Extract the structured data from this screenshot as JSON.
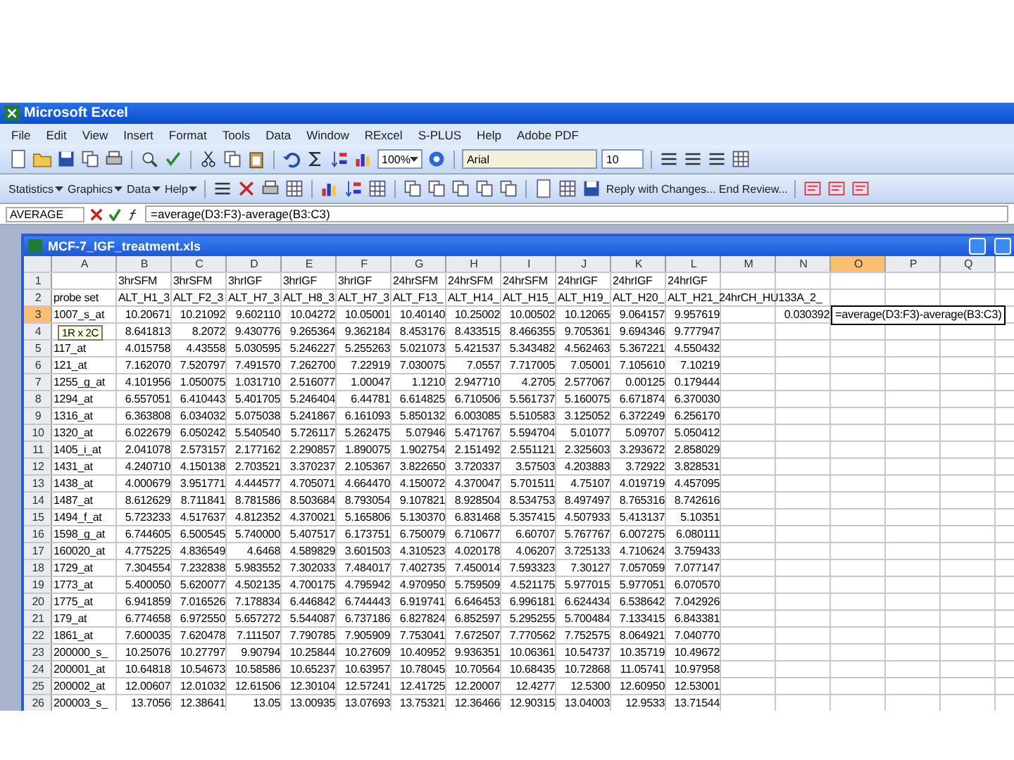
{
  "window": {
    "title": "Microsoft Excel"
  },
  "menu": [
    "File",
    "Edit",
    "View",
    "Insert",
    "Format",
    "Tools",
    "Data",
    "Window",
    "RExcel",
    "S-PLUS",
    "Help",
    "Adobe PDF"
  ],
  "toolbar": {
    "zoom": "100%",
    "font": "Arial",
    "font_size": "10"
  },
  "toolbar2": {
    "menus": [
      "Statistics",
      "Graphics",
      "Data",
      "Help"
    ],
    "review": "Reply with Changes... End Review..."
  },
  "formula_bar": {
    "name_box": "AVERAGE",
    "formula": "=average(D3:F3)-average(B3:C3)"
  },
  "workbook": {
    "title": "MCF-7_IGF_treatment.xls",
    "columns": [
      {
        "label": "A",
        "selected": false
      },
      {
        "label": "B",
        "selected": false
      },
      {
        "label": "C",
        "selected": false
      },
      {
        "label": "D",
        "selected": false
      },
      {
        "label": "E",
        "selected": false
      },
      {
        "label": "F",
        "selected": false
      },
      {
        "label": "G",
        "selected": false
      },
      {
        "label": "H",
        "selected": false
      },
      {
        "label": "I",
        "selected": false
      },
      {
        "label": "J",
        "selected": false
      },
      {
        "label": "K",
        "selected": false
      },
      {
        "label": "L",
        "selected": false
      },
      {
        "label": "M",
        "selected": false
      },
      {
        "label": "N",
        "selected": false
      },
      {
        "label": "O",
        "selected": true
      },
      {
        "label": "P",
        "selected": false
      },
      {
        "label": "Q",
        "selected": false
      }
    ],
    "tooltip": "1R x 2C",
    "rows": [
      {
        "number": "1",
        "selected": false,
        "cells": [
          null,
          "3hrSFM",
          "3hrSFM",
          "3hrIGF",
          "3hrIGF",
          "3hrIGF",
          "24hrSFM",
          "24hrSFM",
          "24hrSFM",
          "24hrIGF",
          "24hrIGF",
          "24hrIGF"
        ]
      },
      {
        "number": "2",
        "selected": false,
        "cells": [
          "probe set",
          "ALT_H1_3",
          "ALT_F2_3",
          "ALT_H7_3",
          "ALT_H8_3",
          "ALT_H7_3",
          "ALT_F13_",
          "ALT_H14_",
          "ALT_H15_",
          "ALT_H19_",
          "ALT_H20_",
          "ALT_H21_24hrCH_HU133A_2_"
        ]
      },
      {
        "number": "3",
        "selected": true,
        "cells": [
          "1007_s_at",
          "10.20671",
          "10.21092",
          "9.602110",
          "10.04272",
          "10.05001",
          "10.40140",
          "10.25002",
          "10.00502",
          "10.12065",
          "9.064157",
          "9.957619",
          null,
          "0.030392"
        ],
        "editing": "=average(D3:F3)-average(B3:C3)"
      },
      {
        "number": "4",
        "selected": false,
        "cells": [
          null,
          "8.641813",
          "8.2072",
          "9.430776",
          "9.265364",
          "9.362184",
          "8.453176",
          "8.433515",
          "8.466355",
          "9.705361",
          "9.694346",
          "9.777947"
        ]
      },
      {
        "number": "5",
        "selected": false,
        "cells": [
          "117_at",
          "4.015758",
          "4.43558",
          "5.030595",
          "5.246227",
          "5.255263",
          "5.021073",
          "5.421537",
          "5.343482",
          "4.562463",
          "5.367221",
          "4.550432"
        ]
      },
      {
        "number": "6",
        "selected": false,
        "cells": [
          "121_at",
          "7.162070",
          "7.520797",
          "7.491570",
          "7.262700",
          "7.22919",
          "7.030075",
          "7.0557",
          "7.717005",
          "7.05001",
          "7.105610",
          "7.10219"
        ]
      },
      {
        "number": "7",
        "selected": false,
        "cells": [
          "1255_g_at",
          "4.101956",
          "1.050075",
          "1.031710",
          "2.516077",
          "1.00047",
          "1.1210",
          "2.947710",
          "4.2705",
          "2.577067",
          "0.00125",
          "0.179444"
        ]
      },
      {
        "number": "8",
        "selected": false,
        "cells": [
          "1294_at",
          "6.557051",
          "6.410443",
          "5.401705",
          "5.246404",
          "6.44781",
          "6.614825",
          "6.710506",
          "5.561737",
          "5.160075",
          "6.671874",
          "6.370030"
        ]
      },
      {
        "number": "9",
        "selected": false,
        "cells": [
          "1316_at",
          "6.363808",
          "6.034032",
          "5.075038",
          "5.241867",
          "6.161093",
          "5.850132",
          "6.003085",
          "5.510583",
          "3.125052",
          "6.372249",
          "6.256170"
        ]
      },
      {
        "number": "10",
        "selected": false,
        "cells": [
          "1320_at",
          "6.022679",
          "6.050242",
          "5.540540",
          "5.726117",
          "5.262475",
          "5.07946",
          "5.471767",
          "5.594704",
          "5.01077",
          "5.09707",
          "5.050412"
        ]
      },
      {
        "number": "11",
        "selected": false,
        "cells": [
          "1405_i_at",
          "2.041078",
          "2.573157",
          "2.177162",
          "2.290857",
          "1.890075",
          "1.902754",
          "2.151492",
          "2.551121",
          "2.325603",
          "3.293672",
          "2.858029"
        ]
      },
      {
        "number": "12",
        "selected": false,
        "cells": [
          "1431_at",
          "4.240710",
          "4.150138",
          "2.703521",
          "3.370237",
          "2.105367",
          "3.822650",
          "3.720337",
          "3.57503",
          "4.203883",
          "3.72922",
          "3.828531"
        ]
      },
      {
        "number": "13",
        "selected": false,
        "cells": [
          "1438_at",
          "4.000679",
          "3.951771",
          "4.444577",
          "4.705071",
          "4.664470",
          "4.150072",
          "4.370047",
          "5.701511",
          "4.75107",
          "4.019719",
          "4.457095"
        ]
      },
      {
        "number": "14",
        "selected": false,
        "cells": [
          "1487_at",
          "8.612629",
          "8.711841",
          "8.781586",
          "8.503684",
          "8.793054",
          "9.107821",
          "8.928504",
          "8.534753",
          "8.497497",
          "8.765316",
          "8.742616"
        ]
      },
      {
        "number": "15",
        "selected": false,
        "cells": [
          "1494_f_at",
          "5.723233",
          "4.517637",
          "4.812352",
          "4.370021",
          "5.165806",
          "5.130370",
          "6.831468",
          "5.357415",
          "4.507933",
          "5.413137",
          "5.10351"
        ]
      },
      {
        "number": "16",
        "selected": false,
        "cells": [
          "1598_g_at",
          "6.744605",
          "6.500545",
          "5.740000",
          "5.407517",
          "6.173751",
          "6.750079",
          "6.710677",
          "6.60707",
          "5.767767",
          "6.007275",
          "6.080111"
        ]
      },
      {
        "number": "17",
        "selected": false,
        "cells": [
          "160020_at",
          "4.775225",
          "4.836549",
          "4.6468",
          "4.589829",
          "3.601503",
          "4.310523",
          "4.020178",
          "4.06207",
          "3.725133",
          "4.710624",
          "3.759433"
        ]
      },
      {
        "number": "18",
        "selected": false,
        "cells": [
          "1729_at",
          "7.304554",
          "7.232838",
          "5.983552",
          "7.302033",
          "7.484017",
          "7.402735",
          "7.450014",
          "7.593323",
          "7.30127",
          "7.057059",
          "7.077147"
        ]
      },
      {
        "number": "19",
        "selected": false,
        "cells": [
          "1773_at",
          "5.400050",
          "5.620077",
          "4.502135",
          "4.700175",
          "4.795942",
          "4.970950",
          "5.759509",
          "4.521175",
          "5.977015",
          "5.977051",
          "6.070570"
        ]
      },
      {
        "number": "20",
        "selected": false,
        "cells": [
          "1775_at",
          "6.941859",
          "7.016526",
          "7.178834",
          "6.446842",
          "6.744443",
          "6.919741",
          "6.646453",
          "6.996181",
          "6.624434",
          "6.538642",
          "7.042926"
        ]
      },
      {
        "number": "21",
        "selected": false,
        "cells": [
          "179_at",
          "6.774658",
          "6.972550",
          "5.657272",
          "5.544087",
          "6.737186",
          "6.827824",
          "6.852597",
          "5.295255",
          "5.700484",
          "7.133415",
          "6.843381"
        ]
      },
      {
        "number": "22",
        "selected": false,
        "cells": [
          "1861_at",
          "7.600035",
          "7.620478",
          "7.111507",
          "7.790785",
          "7.905909",
          "7.753041",
          "7.672507",
          "7.770562",
          "7.752575",
          "8.064921",
          "7.040770"
        ]
      },
      {
        "number": "23",
        "selected": false,
        "cells": [
          "200000_s_",
          "10.25076",
          "10.27797",
          "9.90794",
          "10.25844",
          "10.27609",
          "10.40952",
          "9.936351",
          "10.06361",
          "10.54737",
          "10.35719",
          "10.49672"
        ]
      },
      {
        "number": "24",
        "selected": false,
        "cells": [
          "200001_at",
          "10.64818",
          "10.54673",
          "10.58586",
          "10.65237",
          "10.63957",
          "10.78045",
          "10.70564",
          "10.68435",
          "10.72868",
          "11.05741",
          "10.97958"
        ]
      },
      {
        "number": "25",
        "selected": false,
        "cells": [
          "200002_at",
          "12.00607",
          "12.01032",
          "12.61506",
          "12.30104",
          "12.57241",
          "12.41725",
          "12.20007",
          "12.4277",
          "12.5300",
          "12.60950",
          "12.53001"
        ]
      },
      {
        "number": "26",
        "selected": false,
        "cells": [
          "200003_s_",
          "13.7056",
          "12.38641",
          "13.05",
          "13.00935",
          "13.07693",
          "13.75321",
          "12.36466",
          "12.90315",
          "13.04003",
          "12.9533",
          "13.71544"
        ]
      }
    ]
  }
}
